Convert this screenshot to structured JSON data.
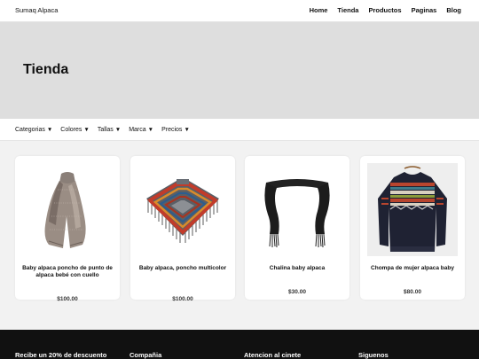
{
  "header": {
    "brand": "Sumaq Alpaca",
    "menu": [
      "Home",
      "Tienda",
      "Productos",
      "Paginas",
      "Blog"
    ]
  },
  "hero": {
    "title": "Tienda"
  },
  "filters": [
    "Categorias",
    "Colores",
    "Tallas",
    "Marca",
    "Precios"
  ],
  "filter_caret": "▼",
  "products": [
    {
      "name": "Baby alpaca poncho de punto de alpaca bebé con cuello",
      "price": "$100.00",
      "image": "poncho-cowl-icon"
    },
    {
      "name": "Baby alpaca, poncho multicolor",
      "price": "$100.00",
      "image": "striped-poncho-icon"
    },
    {
      "name": "Chalina baby alpaca",
      "price": "$30.00",
      "image": "scarf-icon"
    },
    {
      "name": "Chompa de mujer alpaca baby",
      "price": "$80.00",
      "image": "sweater-icon"
    }
  ],
  "footer": {
    "columns": [
      "Recibe un 20% de descuento",
      "Compañia",
      "Atencion al cinete",
      "Siguenos"
    ]
  },
  "colors": {
    "hero_bg": "#dedede",
    "shop_bg": "#f2f2f2",
    "footer_bg": "#111111"
  }
}
